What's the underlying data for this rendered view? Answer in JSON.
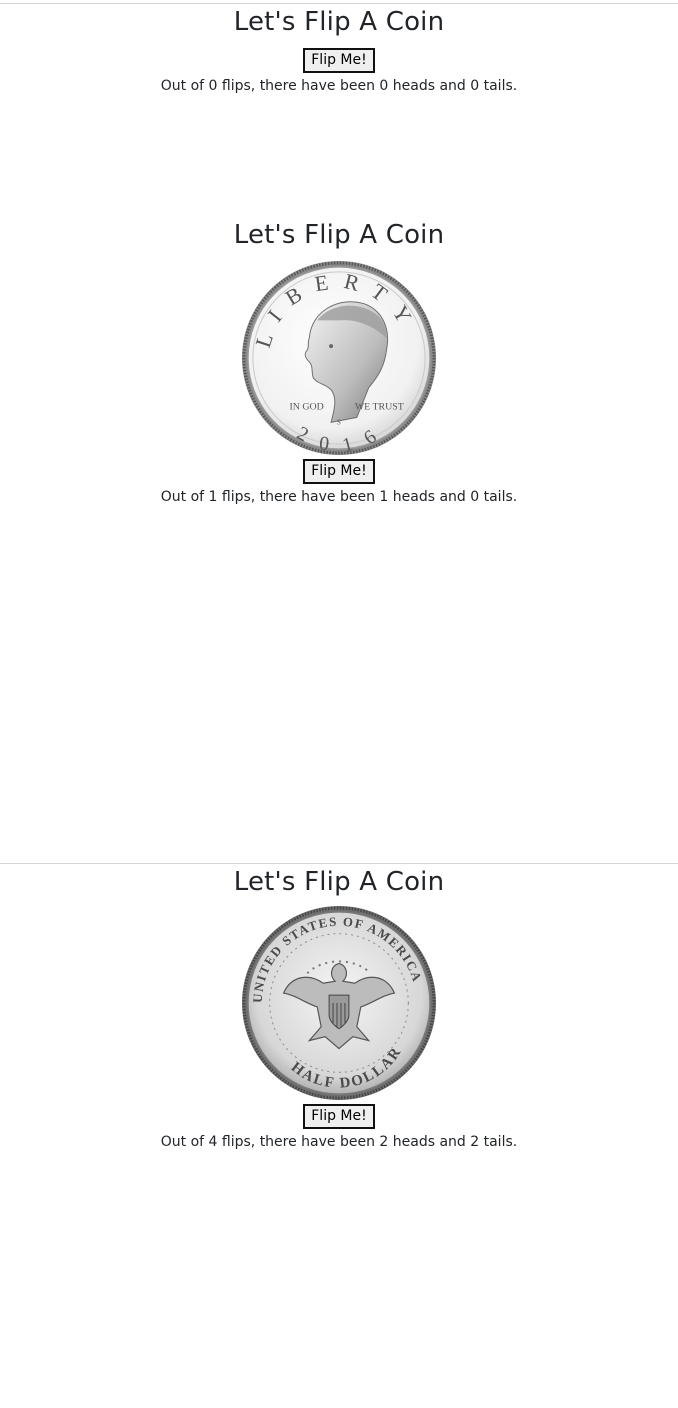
{
  "frames": [
    {
      "title": "Let's Flip A Coin",
      "coin": "none",
      "button_label": "Flip Me!",
      "result_text": "Out of 0 flips, there have been 0 heads and 0 tails.",
      "flips": 0,
      "heads": 0,
      "tails": 0
    },
    {
      "title": "Let's Flip A Coin",
      "coin": "heads",
      "coin_image": {
        "legend_top": "LIBERTY",
        "motto_left": "IN GOD",
        "motto_right": "WE TRUST",
        "mint_mark": "S",
        "year": "2016"
      },
      "button_label": "Flip Me!",
      "result_text": "Out of 1 flips, there have been 1 heads and 0 tails.",
      "flips": 1,
      "heads": 1,
      "tails": 0
    },
    {
      "title": "Let's Flip A Coin",
      "coin": "tails",
      "coin_image": {
        "legend_top": "UNITED STATES OF AMERICA",
        "legend_bottom": "HALF DOLLAR"
      },
      "button_label": "Flip Me!",
      "result_text": "Out of 4 flips, there have been 2 heads and 2 tails.",
      "flips": 4,
      "heads": 2,
      "tails": 2
    }
  ]
}
